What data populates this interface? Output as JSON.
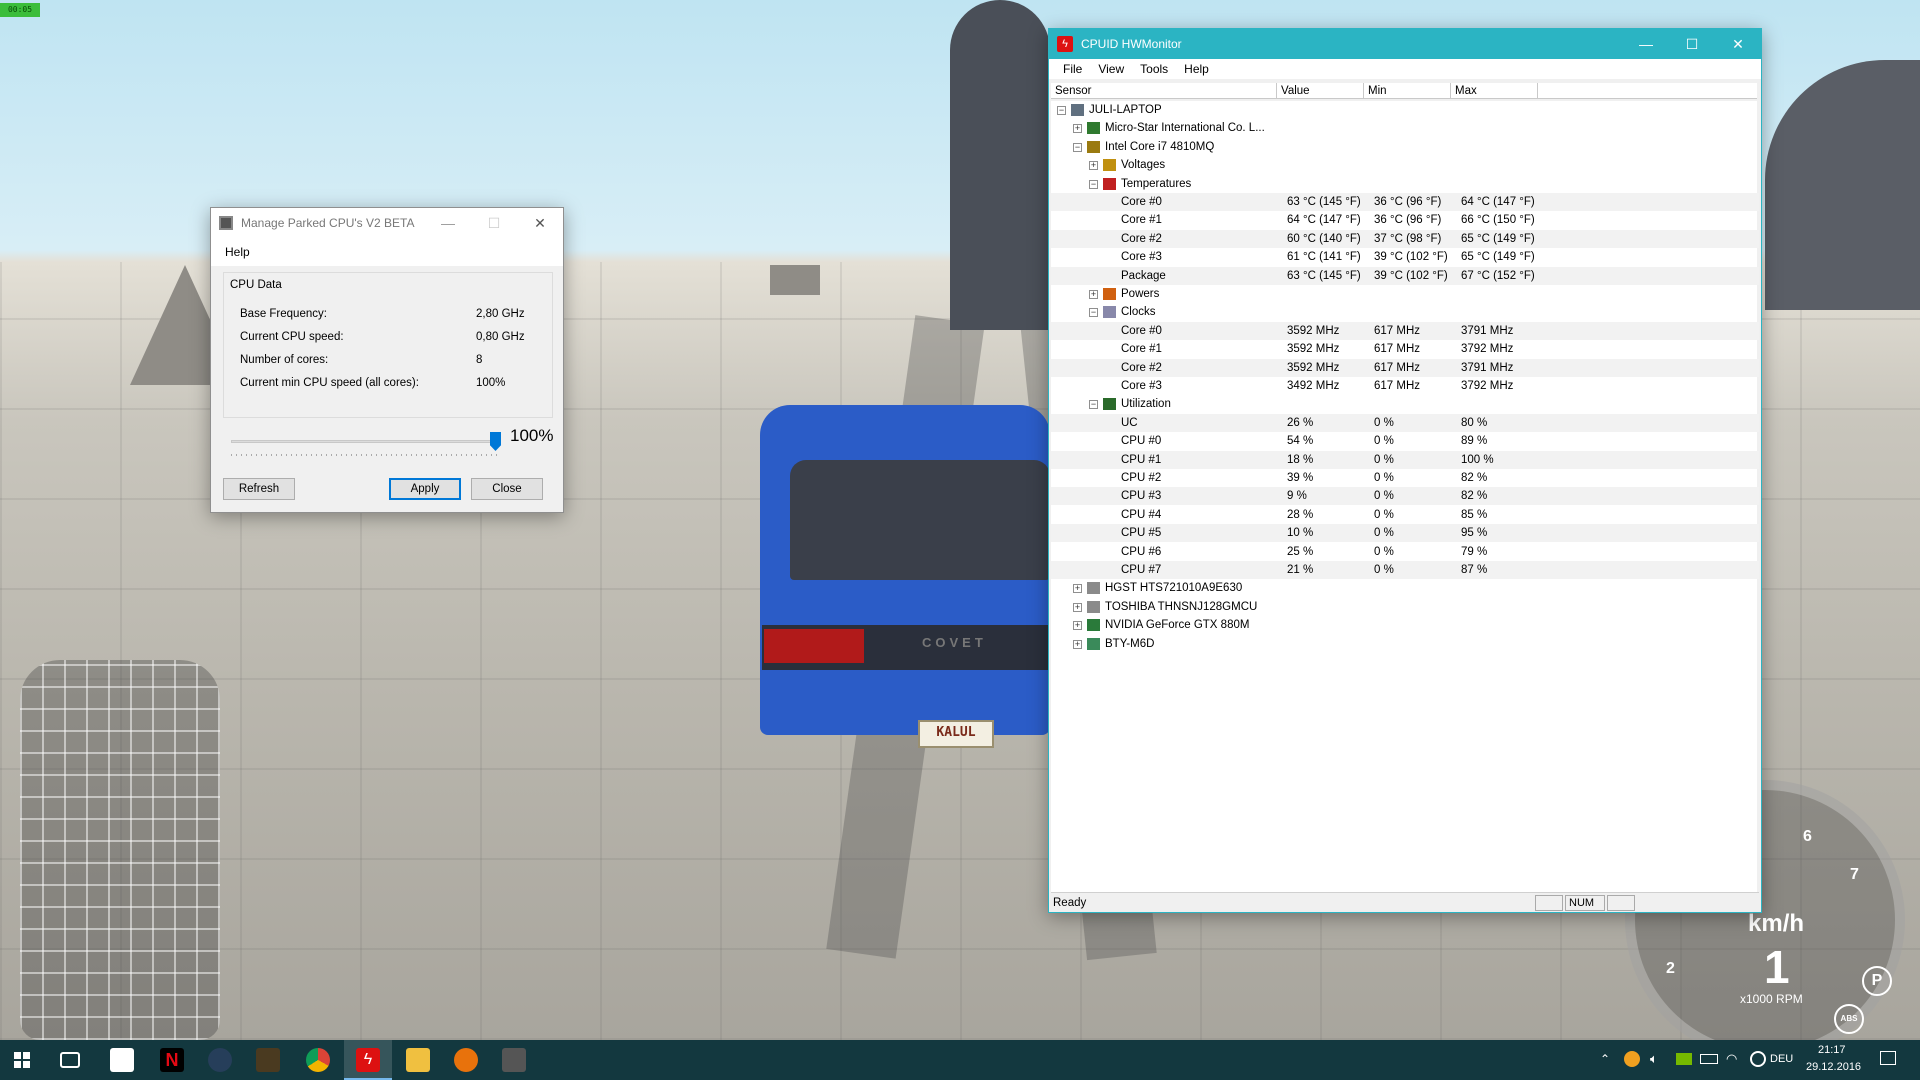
{
  "overlay": {
    "fps": "00:05"
  },
  "scene": {
    "plate": "KALUL",
    "car_brand": "COVET"
  },
  "parked": {
    "title": "Manage Parked CPU's V2 BETA",
    "menu": [
      "Help"
    ],
    "group_title": "CPU Data",
    "rows": [
      {
        "label": "Base Frequency:",
        "value": "2,80 GHz"
      },
      {
        "label": "Current CPU speed:",
        "value": "0,80 GHz"
      },
      {
        "label": "Number of cores:",
        "value": "8"
      },
      {
        "label": "Current min CPU speed (all cores):",
        "value": "100%"
      }
    ],
    "slider_value": 1.0,
    "slider_label": "100%",
    "refresh_label": "Refresh",
    "apply_label": "Apply",
    "close_label": "Close"
  },
  "hw": {
    "title": "CPUID HWMonitor",
    "menu": [
      "File",
      "View",
      "Tools",
      "Help"
    ],
    "columns": [
      "Sensor",
      "Value",
      "Min",
      "Max"
    ],
    "status": "Ready",
    "num": "NUM",
    "tree": [
      {
        "indent": 0,
        "exp": "-",
        "icon": "computer-icon",
        "label": "JULI-LAPTOP"
      },
      {
        "indent": 1,
        "exp": "+",
        "icon": "motherboard-icon",
        "label": "Micro-Star International Co. L..."
      },
      {
        "indent": 1,
        "exp": "-",
        "icon": "cpu-icon",
        "label": "Intel Core i7 4810MQ"
      },
      {
        "indent": 2,
        "exp": "+",
        "icon": "voltage-icon",
        "label": "Voltages"
      },
      {
        "indent": 2,
        "exp": "-",
        "icon": "thermometer-icon",
        "label": "Temperatures"
      },
      {
        "indent": 3,
        "label": "Core #0",
        "value": "63 °C  (145 °F)",
        "min": "36 °C  (96 °F)",
        "max": "64 °C  (147 °F)",
        "alt": true
      },
      {
        "indent": 3,
        "label": "Core #1",
        "value": "64 °C  (147 °F)",
        "min": "36 °C  (96 °F)",
        "max": "66 °C  (150 °F)"
      },
      {
        "indent": 3,
        "label": "Core #2",
        "value": "60 °C  (140 °F)",
        "min": "37 °C  (98 °F)",
        "max": "65 °C  (149 °F)",
        "alt": true
      },
      {
        "indent": 3,
        "label": "Core #3",
        "value": "61 °C  (141 °F)",
        "min": "39 °C  (102 °F)",
        "max": "65 °C  (149 °F)"
      },
      {
        "indent": 3,
        "label": "Package",
        "value": "63 °C  (145 °F)",
        "min": "39 °C  (102 °F)",
        "max": "67 °C  (152 °F)",
        "alt": true
      },
      {
        "indent": 2,
        "exp": "+",
        "icon": "power-icon",
        "label": "Powers"
      },
      {
        "indent": 2,
        "exp": "-",
        "icon": "clock-icon",
        "label": "Clocks"
      },
      {
        "indent": 3,
        "label": "Core #0",
        "value": "3592 MHz",
        "min": "617 MHz",
        "max": "3791 MHz",
        "alt": true
      },
      {
        "indent": 3,
        "label": "Core #1",
        "value": "3592 MHz",
        "min": "617 MHz",
        "max": "3792 MHz"
      },
      {
        "indent": 3,
        "label": "Core #2",
        "value": "3592 MHz",
        "min": "617 MHz",
        "max": "3791 MHz",
        "alt": true
      },
      {
        "indent": 3,
        "label": "Core #3",
        "value": "3492 MHz",
        "min": "617 MHz",
        "max": "3792 MHz"
      },
      {
        "indent": 2,
        "exp": "-",
        "icon": "utilization-icon",
        "label": "Utilization"
      },
      {
        "indent": 3,
        "label": "UC",
        "value": "26 %",
        "min": "0 %",
        "max": "80 %",
        "alt": true
      },
      {
        "indent": 3,
        "label": "CPU #0",
        "value": "54 %",
        "min": "0 %",
        "max": "89 %"
      },
      {
        "indent": 3,
        "label": "CPU #1",
        "value": "18 %",
        "min": "0 %",
        "max": "100 %",
        "alt": true
      },
      {
        "indent": 3,
        "label": "CPU #2",
        "value": "39 %",
        "min": "0 %",
        "max": "82 %"
      },
      {
        "indent": 3,
        "label": "CPU #3",
        "value": "9 %",
        "min": "0 %",
        "max": "82 %",
        "alt": true
      },
      {
        "indent": 3,
        "label": "CPU #4",
        "value": "28 %",
        "min": "0 %",
        "max": "85 %"
      },
      {
        "indent": 3,
        "label": "CPU #5",
        "value": "10 %",
        "min": "0 %",
        "max": "95 %",
        "alt": true
      },
      {
        "indent": 3,
        "label": "CPU #6",
        "value": "25 %",
        "min": "0 %",
        "max": "79 %"
      },
      {
        "indent": 3,
        "label": "CPU #7",
        "value": "21 %",
        "min": "0 %",
        "max": "87 %",
        "alt": true
      },
      {
        "indent": 1,
        "exp": "+",
        "icon": "hdd-icon",
        "label": "HGST HTS721010A9E630"
      },
      {
        "indent": 1,
        "exp": "+",
        "icon": "hdd-icon",
        "label": "TOSHIBA THNSNJ128GMCU"
      },
      {
        "indent": 1,
        "exp": "+",
        "icon": "gpu-icon",
        "label": "NVIDIA GeForce GTX 880M"
      },
      {
        "indent": 1,
        "exp": "+",
        "icon": "battery-icon",
        "label": "BTY-M6D"
      }
    ]
  },
  "hud": {
    "unit": "km/h",
    "rpm_label": "x1000 RPM",
    "gear": "1",
    "ticks": [
      "2",
      "6",
      "7"
    ],
    "park": "P",
    "abs": "ABS"
  },
  "taskbar": {
    "lang": "DEU",
    "time": "21:17",
    "date": "29.12.2016"
  },
  "colors": {
    "hw_title": "#2bb4c3",
    "taskbar": "#13383f",
    "accent": "#0078d7"
  }
}
